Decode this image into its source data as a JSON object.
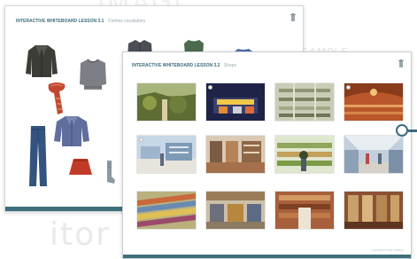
{
  "watermarks": {
    "top": "IMAGE",
    "middle": "SAMPLE",
    "bottom": "itor",
    "right": "S"
  },
  "back_window": {
    "title": "INTERACTIVE WHITEBOARD LESSON 3.1",
    "subtitle": "Clothes vocabulary",
    "items": [
      "leather jacket",
      "sweater",
      "scarf",
      "jeans",
      "blue jacket",
      "red skirt",
      "socks",
      "jacket",
      "green top",
      "blouse"
    ]
  },
  "front_window": {
    "title": "INTERACTIVE WHITEBOARD LESSON 3.2",
    "subtitle": "Shops",
    "footer_text": "CORNERSTONE SAMPLE",
    "photos": [
      "garden shop",
      "night market",
      "clothes shop",
      "theatre",
      "supermarket",
      "shoe shop",
      "grocery",
      "shopping centre",
      "textile shop",
      "department store",
      "book shop",
      "cafe"
    ]
  },
  "colors": {
    "accent": "#3e6f7b",
    "title": "#3b6c7a",
    "border": "#d3d8dc"
  },
  "icons": {
    "window_icon": "bin-icon",
    "next_handle": "circle-arrow-icon"
  }
}
